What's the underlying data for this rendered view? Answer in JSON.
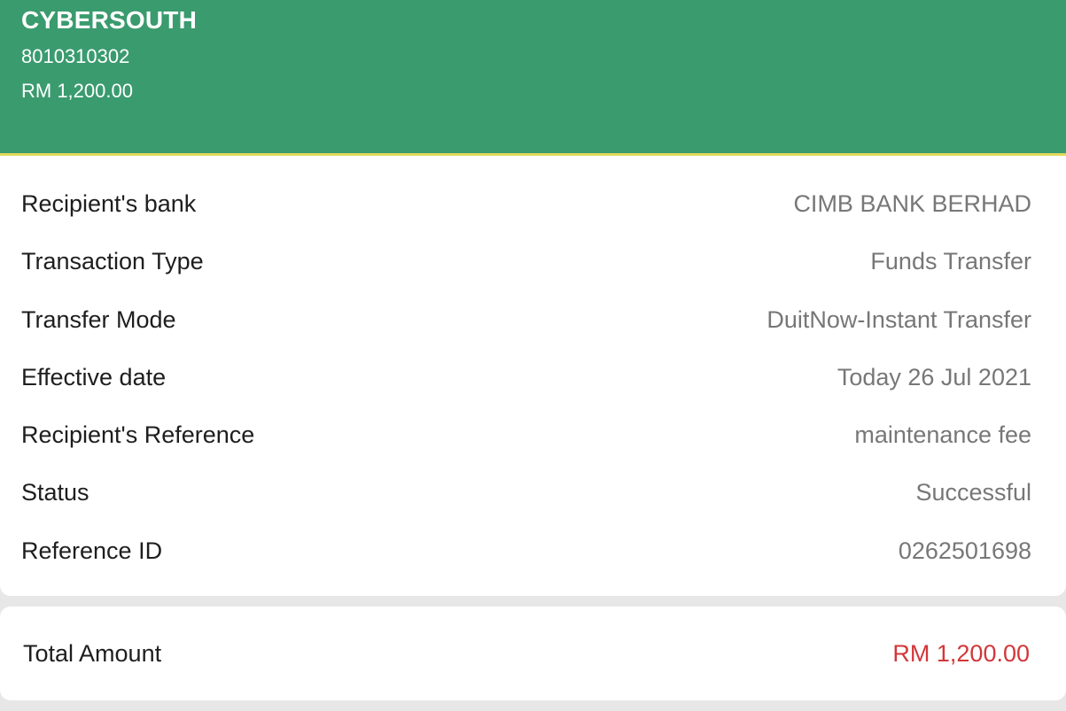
{
  "header": {
    "recipient_name": "CYBERSOUTH",
    "account_number": "8010310302",
    "amount": "RM 1,200.00"
  },
  "details": [
    {
      "label": "Recipient's bank",
      "value": "CIMB BANK BERHAD"
    },
    {
      "label": "Transaction Type",
      "value": "Funds Transfer"
    },
    {
      "label": "Transfer Mode",
      "value": "DuitNow-Instant Transfer"
    },
    {
      "label": "Effective date",
      "value": "Today 26 Jul 2021"
    },
    {
      "label": "Recipient's Reference",
      "value": "maintenance fee"
    },
    {
      "label": "Status",
      "value": "Successful"
    },
    {
      "label": "Reference ID",
      "value": "0262501698"
    }
  ],
  "total": {
    "label": "Total Amount",
    "value": "RM 1,200.00"
  },
  "colors": {
    "header_bg": "#3a9b6e",
    "header_border": "#e2d95a",
    "total_value": "#d2373a"
  }
}
